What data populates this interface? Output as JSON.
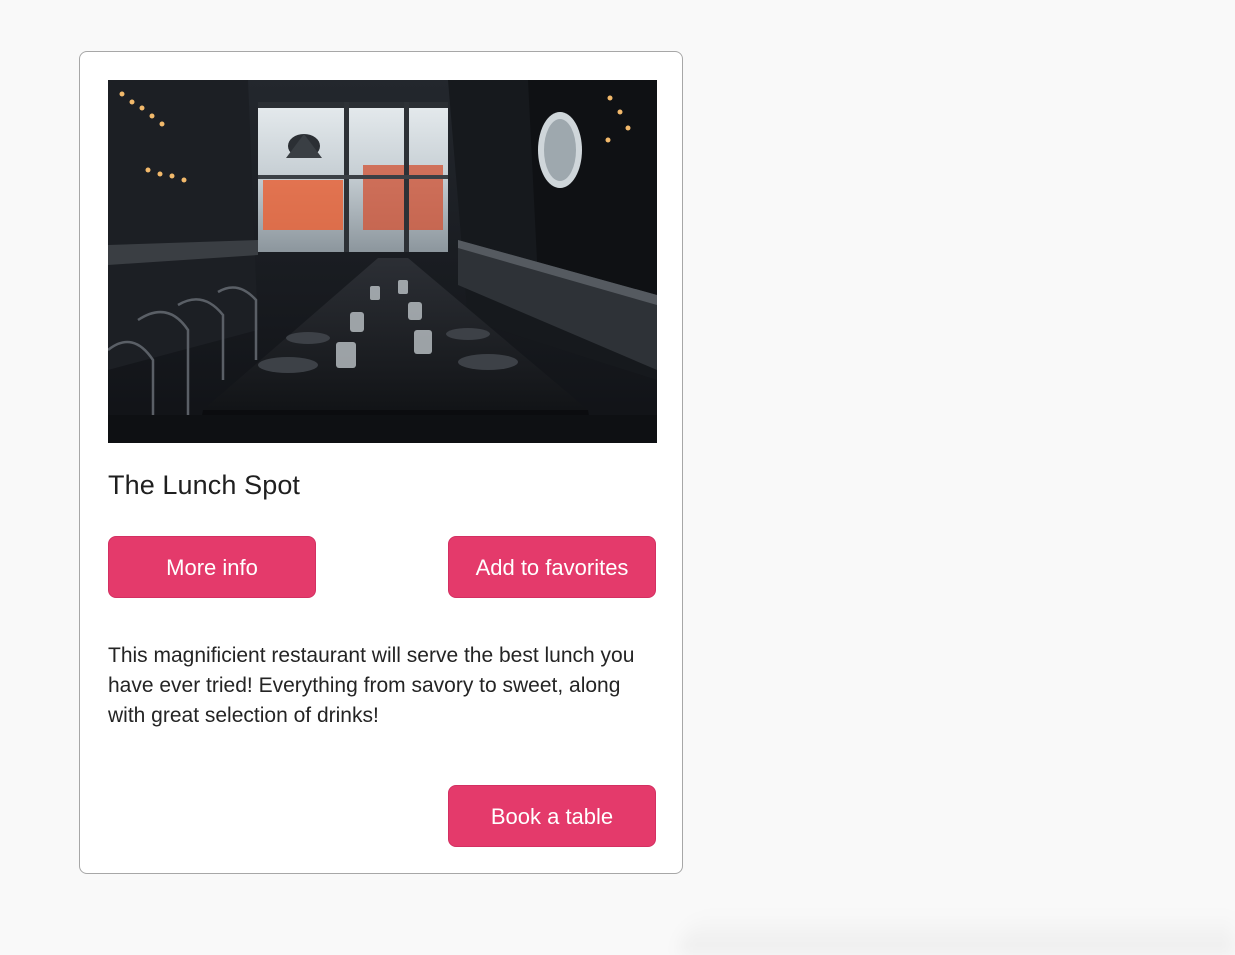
{
  "card": {
    "image_alt": "Restaurant interior with long table",
    "title": "The Lunch Spot",
    "more_info_label": "More info",
    "favorites_label": "Add to favorites",
    "description": "This magnificient restaurant will serve the best lunch you have ever tried! Everything from savory to sweet, along with great selection of drinks!",
    "book_label": "Book a table"
  },
  "colors": {
    "page_background": "#f9f9f9",
    "card_background": "#ffffff",
    "card_border": "#a7a7a7",
    "button_accent": "#e43a6b",
    "button_text": "#ffffff"
  }
}
